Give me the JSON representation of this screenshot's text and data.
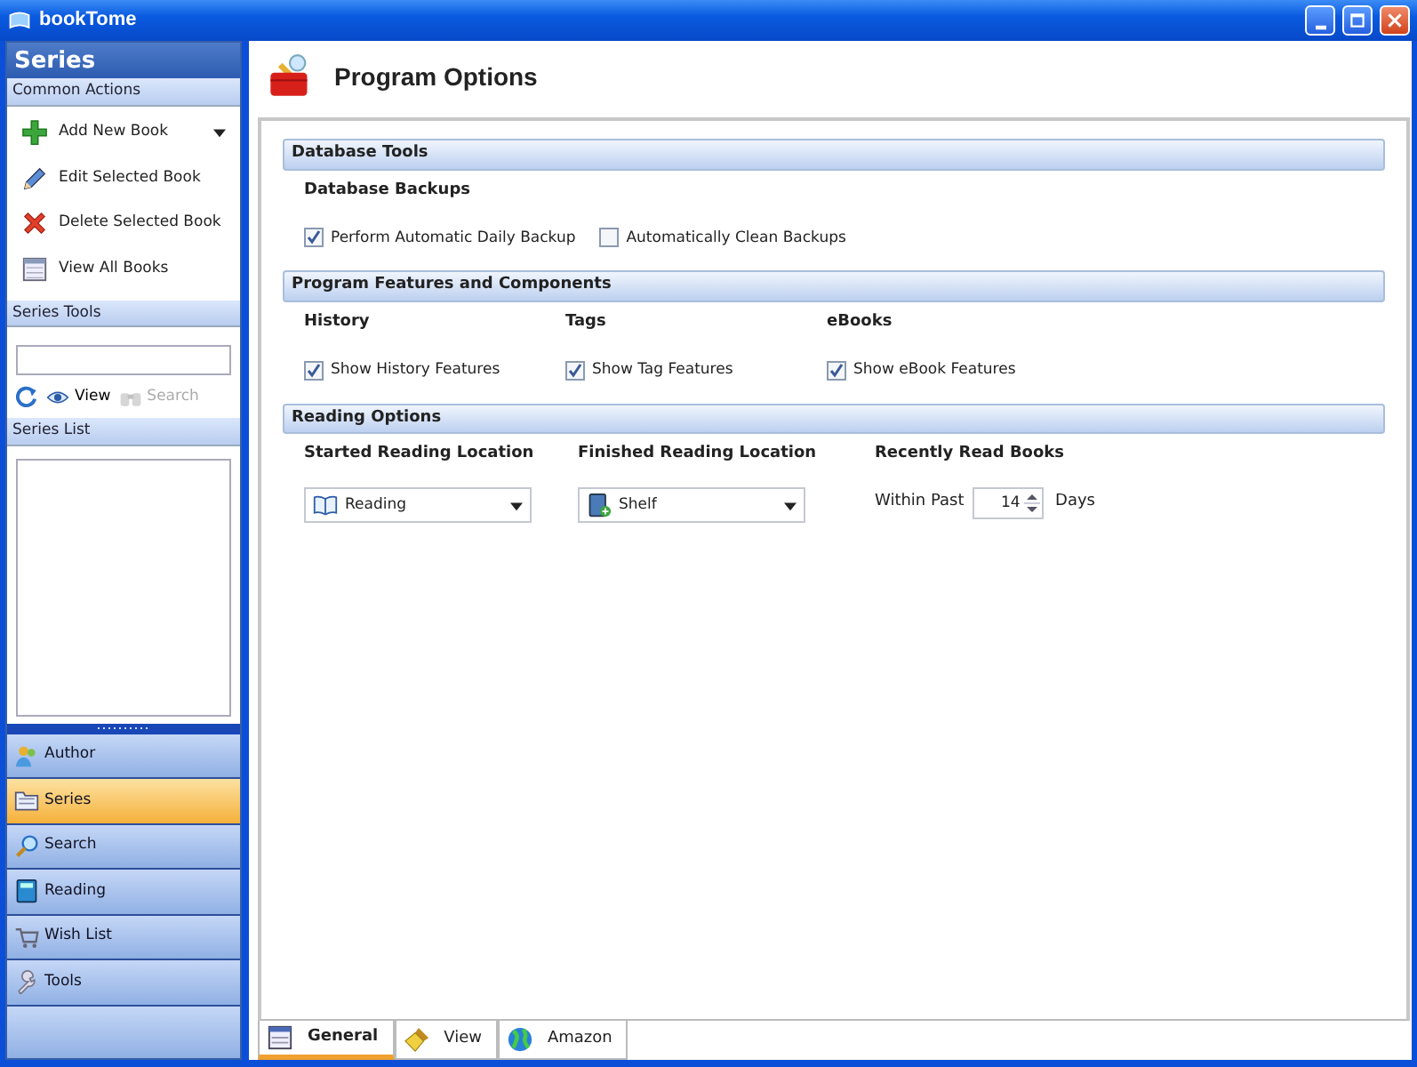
{
  "window": {
    "title": "bookTome"
  },
  "sidebar": {
    "title": "Series",
    "common_actions": {
      "title": "Common Actions",
      "items": [
        {
          "label": "Add New Book",
          "kind": "add",
          "has_dropdown": true
        },
        {
          "label": "Edit Selected Book",
          "kind": "edit",
          "has_dropdown": false
        },
        {
          "label": "Delete Selected Book",
          "kind": "delete",
          "has_dropdown": false
        },
        {
          "label": "View All Books",
          "kind": "view",
          "has_dropdown": false
        }
      ]
    },
    "series_tools": {
      "title": "Series Tools",
      "buttons": [
        {
          "kind": "refresh",
          "disabled": false
        },
        {
          "label": "View",
          "kind": "eye",
          "disabled": false
        },
        {
          "label": "Search",
          "kind": "binoculars",
          "disabled": true
        }
      ]
    },
    "series_list": {
      "title": "Series List"
    },
    "nav": [
      {
        "label": "Author",
        "kind": "author",
        "selected": false
      },
      {
        "label": "Series",
        "kind": "series",
        "selected": true
      },
      {
        "label": "Search",
        "kind": "search",
        "selected": false
      },
      {
        "label": "Reading",
        "kind": "reading",
        "selected": false
      },
      {
        "label": "Wish List",
        "kind": "wishlist",
        "selected": false
      },
      {
        "label": "Tools",
        "kind": "tools",
        "selected": false
      }
    ]
  },
  "main": {
    "title": "Program Options",
    "sections": [
      {
        "title": "Database Tools",
        "groups": [
          {
            "heading": "Database Backups",
            "kind": "checks",
            "items": [
              {
                "label": "Perform Automatic Daily Backup",
                "checked": true
              },
              {
                "label": "Automatically Clean Backups",
                "checked": false
              }
            ]
          }
        ]
      },
      {
        "title": "Program Features and Components",
        "groups": [
          {
            "heading": "History",
            "kind": "checks",
            "items": [
              {
                "label": "Show History Features",
                "checked": true
              }
            ]
          },
          {
            "heading": "Tags",
            "kind": "checks",
            "items": [
              {
                "label": "Show Tag Features",
                "checked": true
              }
            ]
          },
          {
            "heading": "eBooks",
            "kind": "checks",
            "items": [
              {
                "label": "Show eBook Features",
                "checked": true
              }
            ]
          }
        ]
      },
      {
        "title": "Reading Options",
        "groups": [
          {
            "heading": "Started Reading Location",
            "kind": "select",
            "value": "Reading"
          },
          {
            "heading": "Finished Reading Location",
            "kind": "select",
            "value": "Shelf"
          },
          {
            "heading": "Recently Read Books",
            "kind": "spin",
            "prefix": "Within Past",
            "value": "14",
            "suffix": "Days"
          }
        ]
      }
    ]
  },
  "tabs": [
    {
      "label": "General",
      "kind": "general",
      "selected": true
    },
    {
      "label": "View",
      "kind": "brush",
      "selected": false
    },
    {
      "label": "Amazon",
      "kind": "globe",
      "selected": false
    }
  ]
}
